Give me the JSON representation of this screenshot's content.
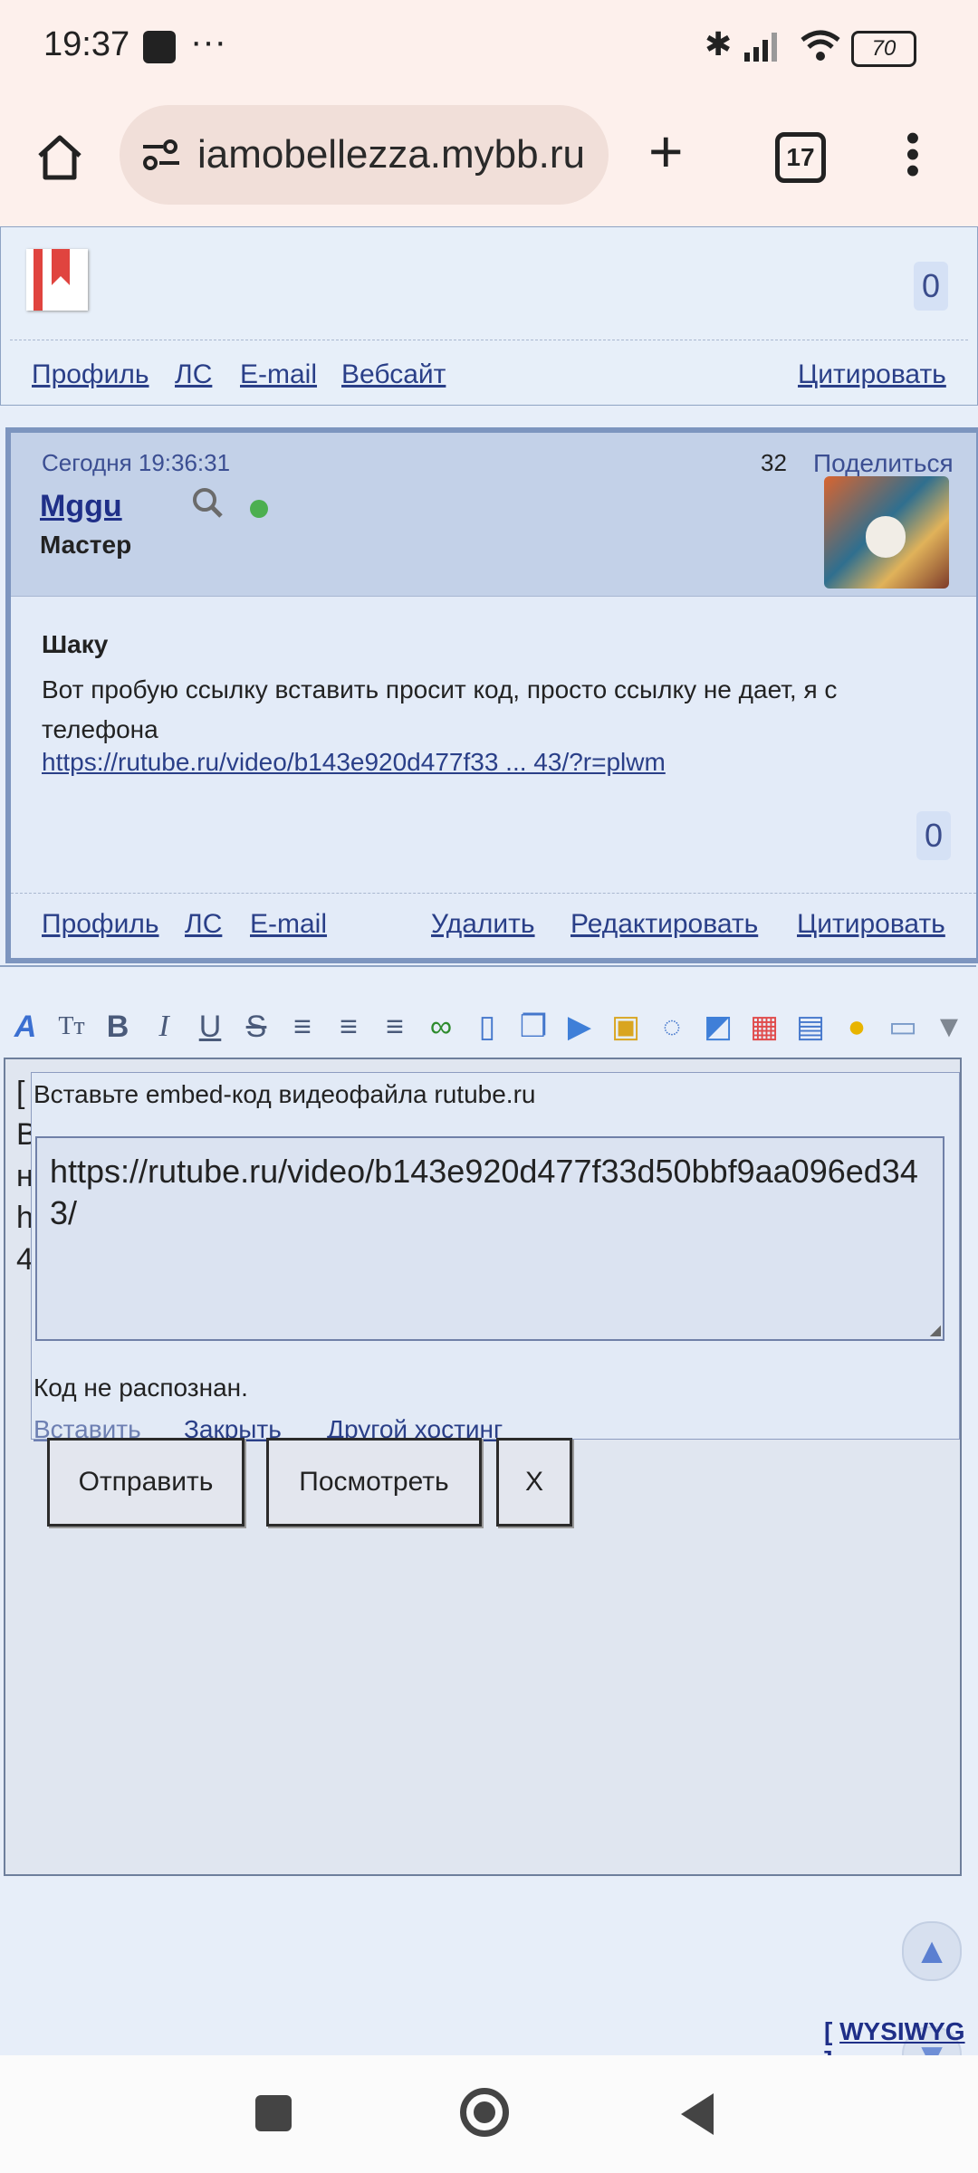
{
  "status": {
    "time": "19:37",
    "more": "···",
    "battery": "70"
  },
  "browser": {
    "url": "iamobellezza.mybb.ru",
    "tab_count": "17"
  },
  "post1": {
    "count": "0",
    "links": [
      "Профиль",
      "ЛС",
      "E-mail",
      "Вебсайт"
    ],
    "quote": "Цитировать"
  },
  "post2": {
    "date": "Сегодня 19:36:31",
    "number": "32",
    "share": "Поделиться",
    "author": "Mggu",
    "rank": "Мастер",
    "body_title": "Шаку",
    "body_text": "Вот пробую ссылку вставить просит код, просто ссылку не дает, я с телефона",
    "body_link": "https://rutube.ru/video/b143e920d477f33 ... 43/?r=plwm",
    "count": "0",
    "links": [
      "Профиль",
      "ЛС",
      "E-mail"
    ],
    "actions": [
      "Удалить",
      "Редактировать",
      "Цитировать"
    ]
  },
  "editor": {
    "toolbar": [
      "font-icon",
      "size-icon",
      "bold-icon",
      "italic-icon",
      "underline-icon",
      "strike-icon",
      "align-left-icon",
      "align-center-icon",
      "align-right-icon",
      "link-icon",
      "book-icon",
      "copy-icon",
      "video-icon",
      "lock-icon",
      "speech-icon",
      "image-icon",
      "color-icon",
      "table-icon",
      "smile-icon",
      "keyboard-icon",
      "more-icon"
    ],
    "behind_text": [
      "[",
      "В",
      "н",
      "h",
      "4"
    ],
    "popup": {
      "title": "Вставьте embed-код видеофайла rutube.ru",
      "value": "https://rutube.ru/video/b143e920d477f33d50bbf9aa096ed343/",
      "message": "Код не распознан.",
      "insert": "Вставить",
      "close": "Закрыть",
      "other": "Другой хостинг"
    },
    "wysiwyg": "WYSIWYG",
    "buttons": {
      "send": "Отправить",
      "preview": "Посмотреть",
      "close": "X"
    }
  }
}
